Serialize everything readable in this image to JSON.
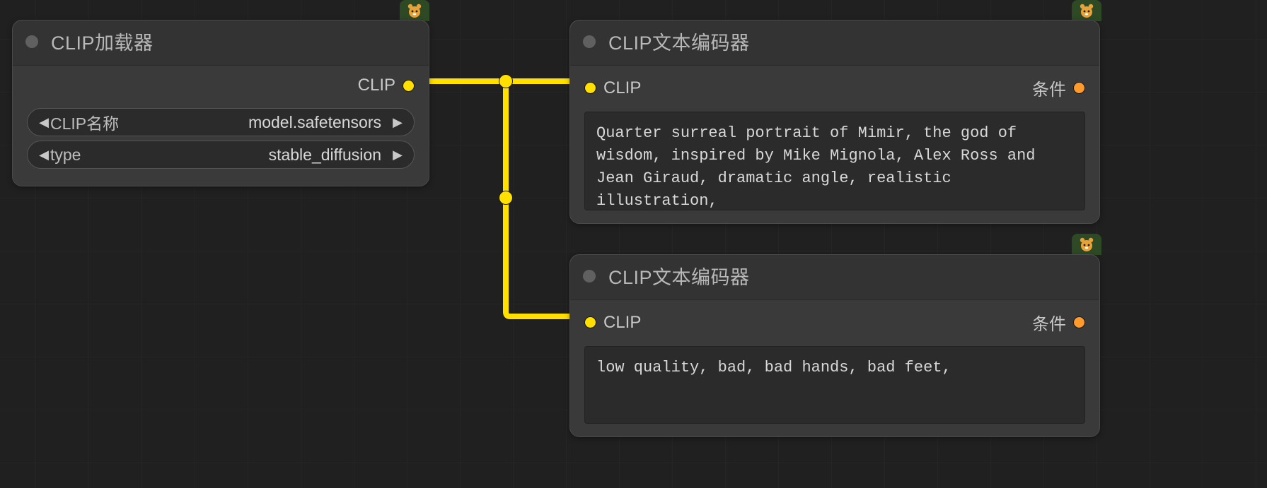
{
  "colors": {
    "wire": "#ffe000",
    "port_clip": "#ffe000",
    "port_cond": "#ff9a2b"
  },
  "loader": {
    "title": "CLIP加载器",
    "output_label": "CLIP",
    "widgets": {
      "clip_name": {
        "label": "CLIP名称",
        "value": "model.safetensors"
      },
      "type": {
        "label": "type",
        "value": "stable_diffusion"
      }
    }
  },
  "encoder_pos": {
    "title": "CLIP文本编码器",
    "input_label": "CLIP",
    "output_label": "条件",
    "text": "Quarter surreal portrait of Mimir, the god of wisdom, inspired by Mike Mignola, Alex Ross and Jean Giraud, dramatic angle, realistic illustration,"
  },
  "encoder_neg": {
    "title": "CLIP文本编码器",
    "input_label": "CLIP",
    "output_label": "条件",
    "text": "low quality, bad, bad hands, bad feet,"
  }
}
